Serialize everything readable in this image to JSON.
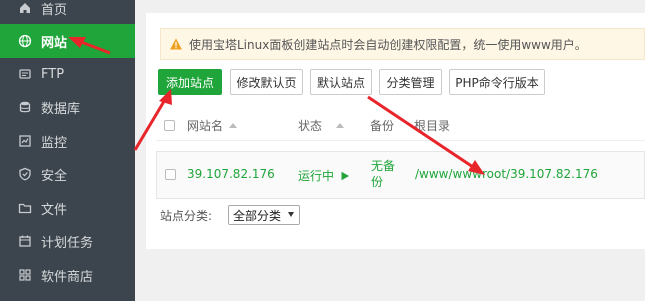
{
  "sidebar": {
    "items": [
      {
        "label": "首页",
        "icon": "home-icon"
      },
      {
        "label": "网站",
        "icon": "globe-icon",
        "active": true
      },
      {
        "label": "FTP",
        "icon": "ftp-icon"
      },
      {
        "label": "数据库",
        "icon": "database-icon"
      },
      {
        "label": "监控",
        "icon": "monitor-icon"
      },
      {
        "label": "安全",
        "icon": "shield-icon"
      },
      {
        "label": "文件",
        "icon": "folder-icon"
      },
      {
        "label": "计划任务",
        "icon": "calendar-icon"
      },
      {
        "label": "软件商店",
        "icon": "apps-icon"
      }
    ]
  },
  "notice": {
    "text": "使用宝塔Linux面板创建站点时会自动创建权限配置，统一使用www用户。",
    "icon": "warning-icon"
  },
  "toolbar": {
    "add_site": "添加站点",
    "edit_default_page": "修改默认页",
    "default_site": "默认站点",
    "category_manage": "分类管理",
    "php_cli_version": "PHP命令行版本"
  },
  "table": {
    "headers": {
      "site_name": "网站名",
      "status": "状态",
      "backup": "备份",
      "root": "根目录"
    },
    "rows": [
      {
        "site_name": "39.107.82.176",
        "status": "运行中",
        "backup_line1": "无备",
        "backup_line2": "份",
        "root": "/www/wwwroot/39.107.82.176"
      }
    ]
  },
  "filter": {
    "label": "站点分类:",
    "selected": "全部分类"
  },
  "colors": {
    "accent": "#20a53a",
    "sidebar_bg": "#3c444d",
    "annotation_arrow": "#e8252b"
  }
}
